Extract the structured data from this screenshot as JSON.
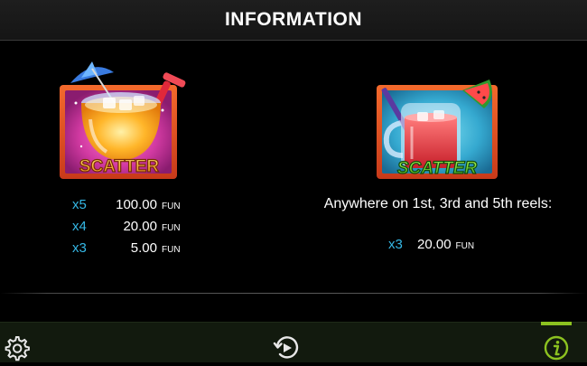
{
  "header": {
    "title": "INFORMATION"
  },
  "symbols": {
    "left": {
      "label": "SCATTER",
      "label_color": "#f8a91e",
      "frame_color": "#e8572a",
      "paytable": [
        {
          "multiplier": "x5",
          "amount": "100.00",
          "unit": "FUN"
        },
        {
          "multiplier": "x4",
          "amount": "20.00",
          "unit": "FUN"
        },
        {
          "multiplier": "x3",
          "amount": "5.00",
          "unit": "FUN"
        }
      ]
    },
    "right": {
      "label": "SCATTER",
      "label_color": "#5fd12a",
      "frame_color": "#e8572a",
      "description": "Anywhere on 1st, 3rd and 5th reels:",
      "paytable": [
        {
          "multiplier": "x3",
          "amount": "20.00",
          "unit": "FUN"
        }
      ]
    }
  },
  "footer": {
    "settings_icon": "gear-icon",
    "autoplay_icon": "autoplay-icon",
    "info_icon": "info-icon",
    "accent_color": "#8cc220"
  }
}
